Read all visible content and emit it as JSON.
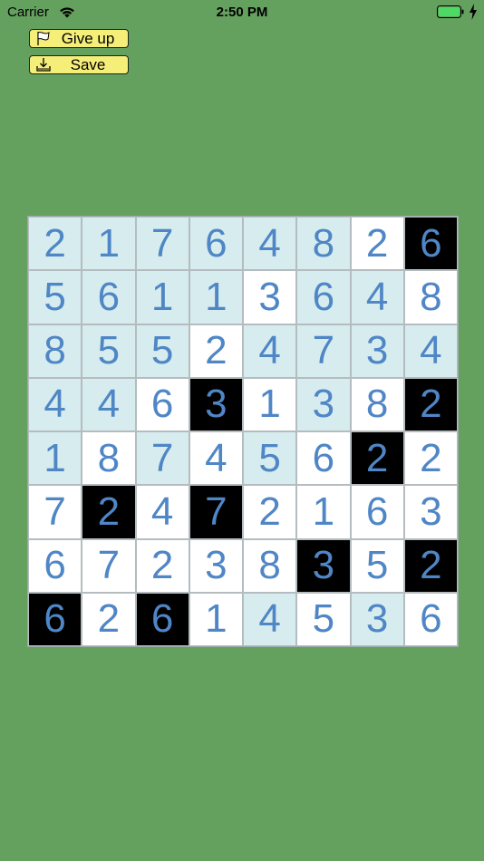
{
  "status_bar": {
    "carrier": "Carrier",
    "time": "2:50 PM",
    "battery_color": "#4cd964"
  },
  "toolbar": {
    "give_up_label": "Give up",
    "give_up_icon": "flag-icon",
    "save_label": "Save",
    "save_icon": "download-tray-icon"
  },
  "colors": {
    "background": "#64a05e",
    "button": "#f5ef7a",
    "digit": "#4f86c6",
    "cell_white": "#ffffff",
    "cell_light": "#d6ecee",
    "cell_black": "#000000"
  },
  "board": {
    "rows": [
      [
        {
          "v": "2",
          "s": "light"
        },
        {
          "v": "1",
          "s": "light"
        },
        {
          "v": "7",
          "s": "light"
        },
        {
          "v": "6",
          "s": "light"
        },
        {
          "v": "4",
          "s": "light"
        },
        {
          "v": "8",
          "s": "light"
        },
        {
          "v": "2",
          "s": "white"
        },
        {
          "v": "6",
          "s": "black"
        }
      ],
      [
        {
          "v": "5",
          "s": "light"
        },
        {
          "v": "6",
          "s": "light"
        },
        {
          "v": "1",
          "s": "light"
        },
        {
          "v": "1",
          "s": "light"
        },
        {
          "v": "3",
          "s": "white"
        },
        {
          "v": "6",
          "s": "light"
        },
        {
          "v": "4",
          "s": "light"
        },
        {
          "v": "8",
          "s": "white"
        }
      ],
      [
        {
          "v": "8",
          "s": "light"
        },
        {
          "v": "5",
          "s": "light"
        },
        {
          "v": "5",
          "s": "light"
        },
        {
          "v": "2",
          "s": "white"
        },
        {
          "v": "4",
          "s": "light"
        },
        {
          "v": "7",
          "s": "light"
        },
        {
          "v": "3",
          "s": "light"
        },
        {
          "v": "4",
          "s": "light"
        }
      ],
      [
        {
          "v": "4",
          "s": "light"
        },
        {
          "v": "4",
          "s": "light"
        },
        {
          "v": "6",
          "s": "white"
        },
        {
          "v": "3",
          "s": "black"
        },
        {
          "v": "1",
          "s": "white"
        },
        {
          "v": "3",
          "s": "light"
        },
        {
          "v": "8",
          "s": "white"
        },
        {
          "v": "2",
          "s": "black"
        }
      ],
      [
        {
          "v": "1",
          "s": "light"
        },
        {
          "v": "8",
          "s": "white"
        },
        {
          "v": "7",
          "s": "light"
        },
        {
          "v": "4",
          "s": "white"
        },
        {
          "v": "5",
          "s": "light"
        },
        {
          "v": "6",
          "s": "white"
        },
        {
          "v": "2",
          "s": "black"
        },
        {
          "v": "2",
          "s": "white"
        }
      ],
      [
        {
          "v": "7",
          "s": "white"
        },
        {
          "v": "2",
          "s": "black"
        },
        {
          "v": "4",
          "s": "white"
        },
        {
          "v": "7",
          "s": "black"
        },
        {
          "v": "2",
          "s": "white"
        },
        {
          "v": "1",
          "s": "white"
        },
        {
          "v": "6",
          "s": "white"
        },
        {
          "v": "3",
          "s": "white"
        }
      ],
      [
        {
          "v": "6",
          "s": "white"
        },
        {
          "v": "7",
          "s": "white"
        },
        {
          "v": "2",
          "s": "white"
        },
        {
          "v": "3",
          "s": "white"
        },
        {
          "v": "8",
          "s": "white"
        },
        {
          "v": "3",
          "s": "black"
        },
        {
          "v": "5",
          "s": "white"
        },
        {
          "v": "2",
          "s": "black"
        }
      ],
      [
        {
          "v": "6",
          "s": "black"
        },
        {
          "v": "2",
          "s": "white"
        },
        {
          "v": "6",
          "s": "black"
        },
        {
          "v": "1",
          "s": "white"
        },
        {
          "v": "4",
          "s": "light"
        },
        {
          "v": "5",
          "s": "white"
        },
        {
          "v": "3",
          "s": "light"
        },
        {
          "v": "6",
          "s": "white"
        }
      ]
    ]
  }
}
